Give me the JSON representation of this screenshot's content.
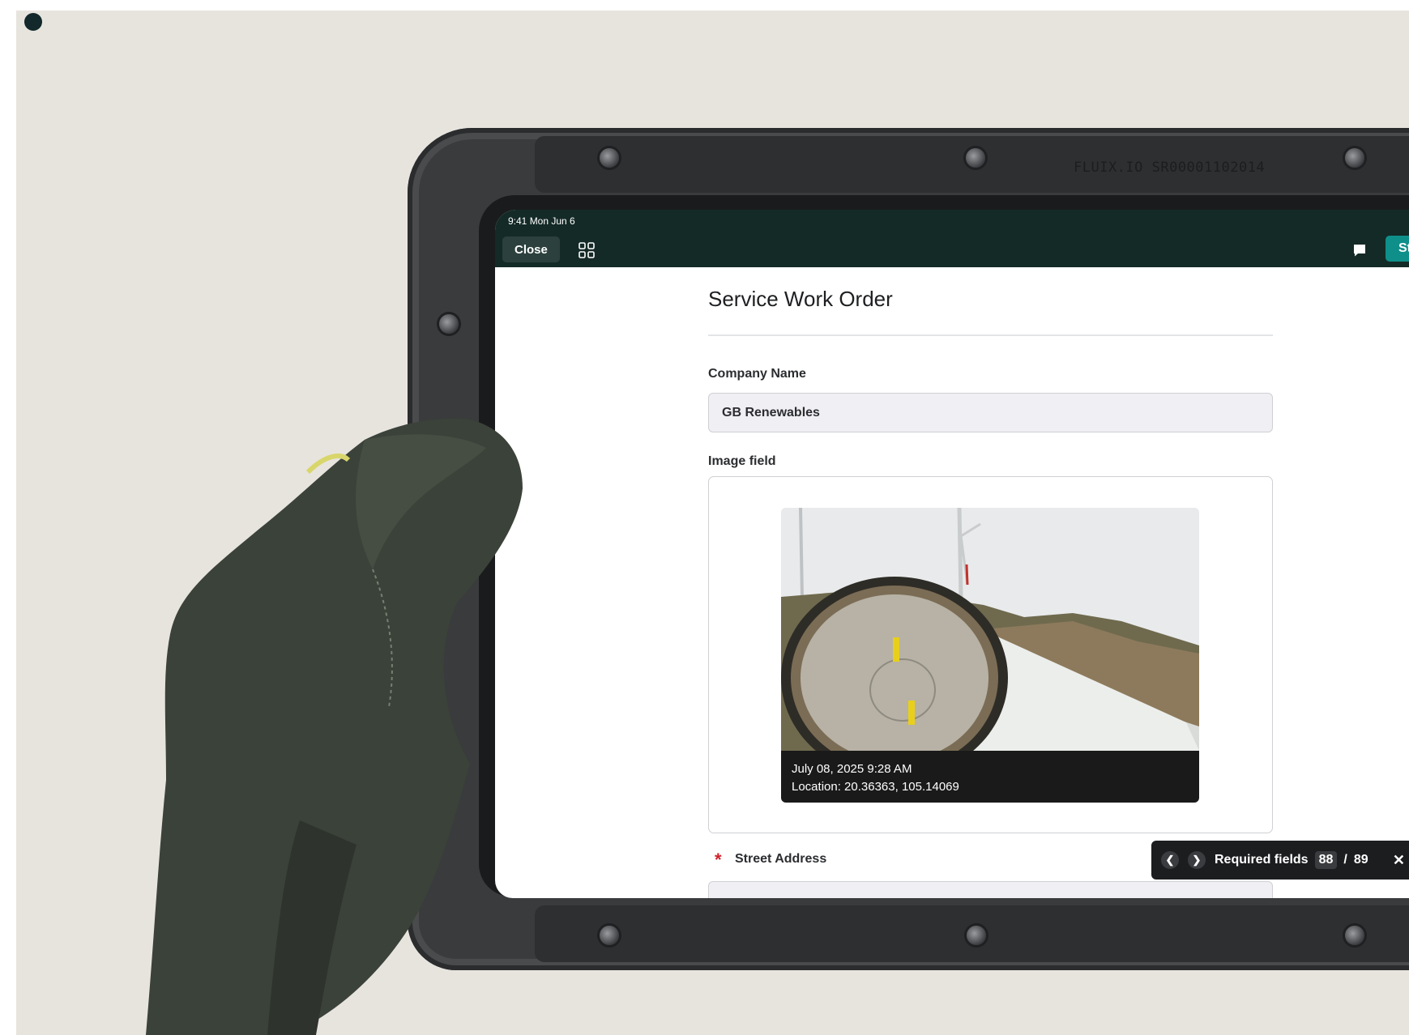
{
  "device": {
    "engraving": "FLUIX.IO SR00001102014"
  },
  "status_bar": {
    "time_date": "9:41  Mon Jun 6"
  },
  "topbar": {
    "close_label": "Close",
    "grid_icon": "grid-icon",
    "chat_icon": "chat-bubble-icon",
    "start_label": "Start"
  },
  "form": {
    "title": "Service Work Order",
    "company": {
      "label": "Company Name",
      "value": "GB Renewables"
    },
    "image_field": {
      "label": "Image field",
      "caption_date": "July 08, 2025 9:28 AM",
      "caption_location": "Location: 20.36363, 105.14069"
    },
    "street": {
      "label": "Street Address",
      "required_marker": "*"
    }
  },
  "required_bar": {
    "prev_icon": "chevron-left-icon",
    "next_icon": "chevron-right-icon",
    "label": "Required fields",
    "current": "88",
    "separator": "/",
    "total": "89",
    "close_icon": "close-icon"
  },
  "colors": {
    "topbar": "#142a27",
    "accent": "#0f8f8a",
    "required": "#d0202a",
    "background": "#e7e4de"
  }
}
